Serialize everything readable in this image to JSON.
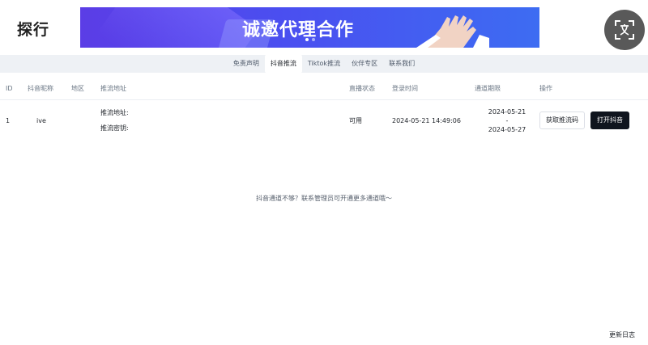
{
  "app": {
    "logo_text": "探行"
  },
  "banner": {
    "headline": "诚邀代理合作",
    "slide_count": 2,
    "active_slide": 1,
    "colors": {
      "start": "#5b3de6",
      "end": "#3d6cf2"
    }
  },
  "translate_button": {
    "icon": "translate-icon"
  },
  "nav": {
    "items": [
      {
        "label": "免责声明",
        "active": false
      },
      {
        "label": "抖音推流",
        "active": true
      },
      {
        "label": "Tiktok推流",
        "active": false
      },
      {
        "label": "伙伴专区",
        "active": false
      },
      {
        "label": "联系我们",
        "active": false
      }
    ]
  },
  "table": {
    "headers": {
      "id": "ID",
      "name": "抖音昵称",
      "region": "地区",
      "address": "推流地址",
      "status": "直播状态",
      "login_time": "登录时间",
      "period": "通道期限",
      "actions": "操作"
    },
    "rows": [
      {
        "id": "1",
        "name": "ive",
        "region": "",
        "address_label": "推流地址:",
        "key_label": "推流密钥:",
        "status": "可用",
        "login_time": "2024-05-21 14:49:06",
        "period_start": "2024-05-21",
        "period_sep": "-",
        "period_end": "2024-05-27",
        "action_get_code": "获取推流码",
        "action_open": "打开抖音"
      }
    ]
  },
  "notice": "抖音通道不够？联系管理员可开通更多通道哦～",
  "footer": {
    "changelog": "更新日志"
  }
}
